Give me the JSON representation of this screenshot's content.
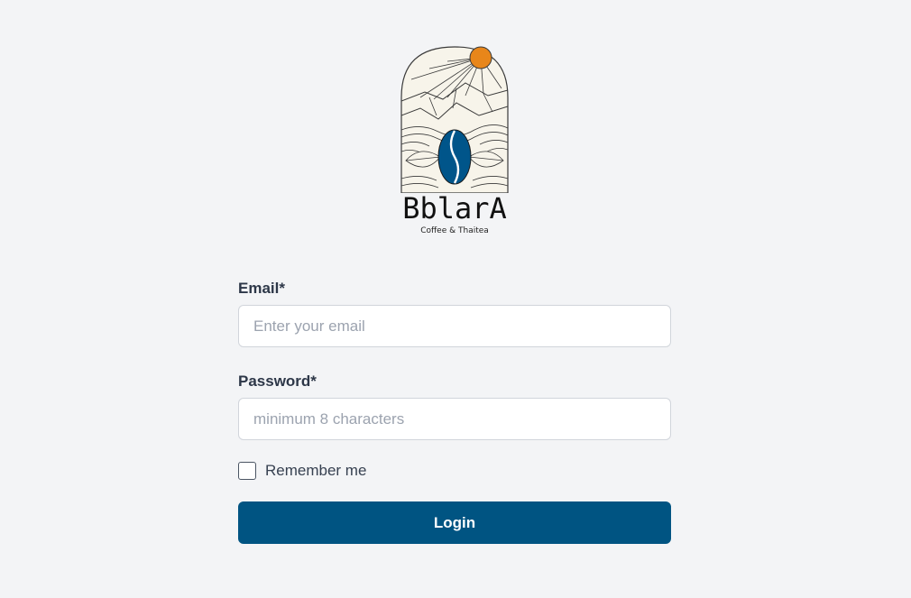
{
  "brand": {
    "name": "BblarA",
    "tagline": "Coffee & Thaitea",
    "logo_icon": "coffee-bean-arch-logo"
  },
  "form": {
    "email": {
      "label": "Email*",
      "placeholder": "Enter your email",
      "value": ""
    },
    "password": {
      "label": "Password*",
      "placeholder": "minimum 8 characters",
      "value": ""
    },
    "remember": {
      "label": "Remember me",
      "checked": false
    },
    "login_label": "Login"
  },
  "colors": {
    "background": "#f3f4f6",
    "primary": "#005482",
    "sun": "#e8861a",
    "bean": "#00558a"
  }
}
